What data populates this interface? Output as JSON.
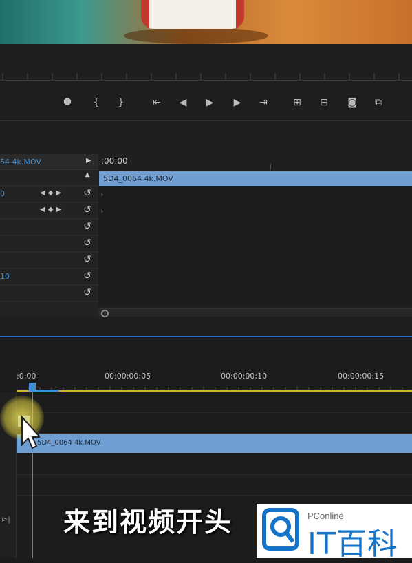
{
  "transport": {
    "buttons": [
      {
        "name": "add-marker-icon",
        "glyph": "⯃"
      },
      {
        "name": "mark-in-icon",
        "glyph": "{"
      },
      {
        "name": "mark-out-icon",
        "glyph": "}"
      },
      {
        "name": "go-to-in-icon",
        "glyph": "⇤"
      },
      {
        "name": "step-back-icon",
        "glyph": "◀"
      },
      {
        "name": "play-icon",
        "glyph": "▶"
      },
      {
        "name": "step-forward-icon",
        "glyph": "▶"
      },
      {
        "name": "go-to-out-icon",
        "glyph": "⇥"
      },
      {
        "name": "lift-icon",
        "glyph": "⊞"
      },
      {
        "name": "extract-icon",
        "glyph": "⊟"
      },
      {
        "name": "export-frame-icon",
        "glyph": "◙"
      },
      {
        "name": "compare-icon",
        "glyph": "⧉"
      }
    ]
  },
  "effect_controls": {
    "source_clip": "54 4k.MOV",
    "timecode": ":00:00",
    "clip_name": "5D4_0064 4k.MOV",
    "rows": [
      {
        "label": "",
        "reset": false
      },
      {
        "label": "0",
        "reset": true,
        "keyframes": true
      },
      {
        "label": "",
        "reset": true,
        "keyframes": true
      },
      {
        "label": "",
        "reset": true
      },
      {
        "label": "",
        "reset": true
      },
      {
        "label": "",
        "reset": true
      },
      {
        "label": "10",
        "reset": true
      },
      {
        "label": "",
        "reset": true
      }
    ]
  },
  "timeline": {
    "timecodes": [
      ":0:00",
      "00:00:00:05",
      "00:00:00:10",
      "00:00:00:15"
    ],
    "clip_name": "5D4_0064 4k.MOV"
  },
  "caption": "来到视频开头",
  "watermark": {
    "small": "PConline",
    "large": "IT百科"
  },
  "colors": {
    "accent": "#3f8fd6",
    "clip": "#6f9fd2",
    "work_area": "#c7b52a",
    "watermark": "#1474c9"
  }
}
